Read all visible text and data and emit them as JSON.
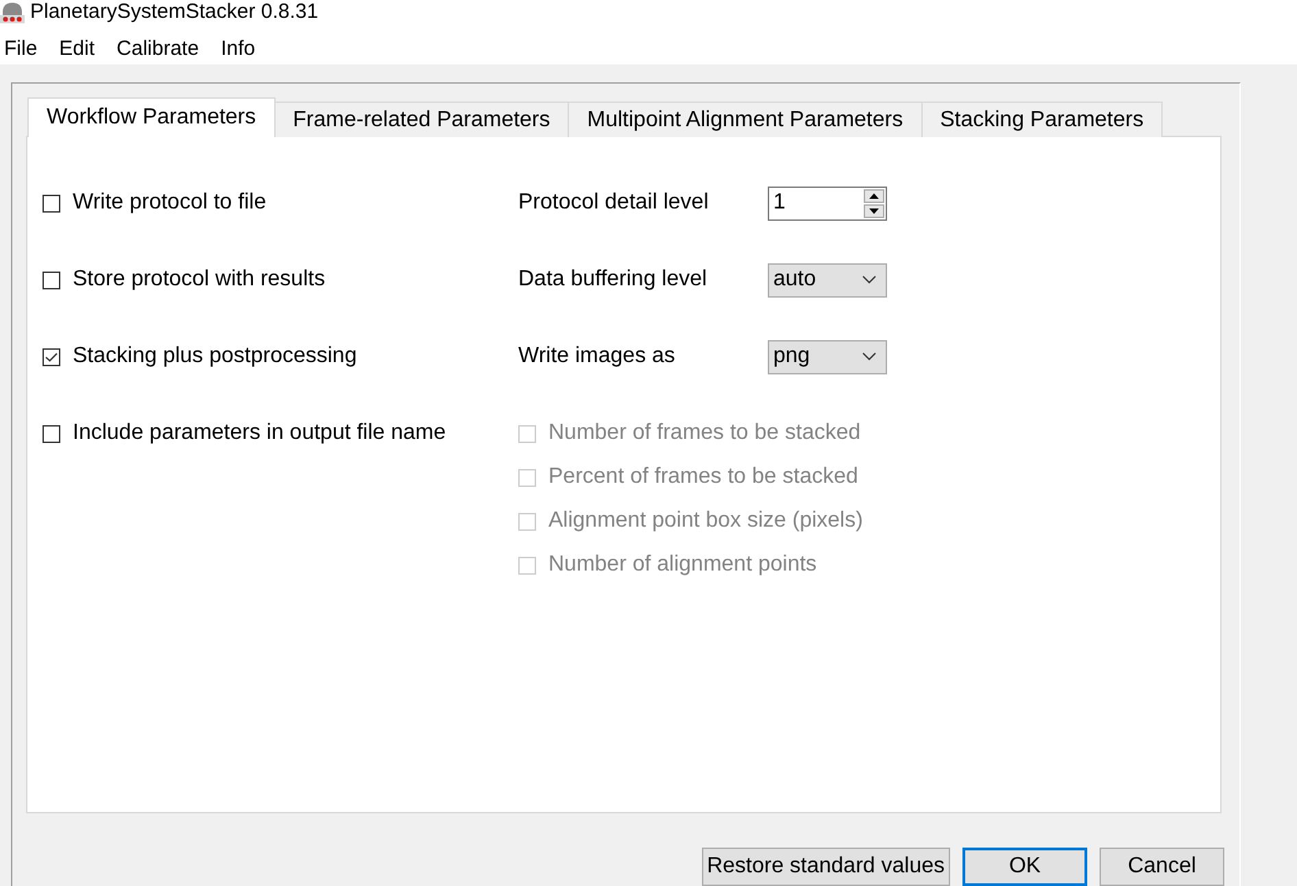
{
  "window": {
    "title": "PlanetarySystemStacker 0.8.31"
  },
  "menu": [
    "File",
    "Edit",
    "Calibrate",
    "Info"
  ],
  "tabs": [
    {
      "label": "Workflow Parameters",
      "selected": true
    },
    {
      "label": "Frame-related Parameters",
      "selected": false
    },
    {
      "label": "Multipoint Alignment Parameters",
      "selected": false
    },
    {
      "label": "Stacking Parameters",
      "selected": false
    }
  ],
  "options": [
    {
      "label": "Write protocol to file",
      "checked": false,
      "disabled": false
    },
    {
      "label": "Store protocol with results",
      "checked": false,
      "disabled": false
    },
    {
      "label": "Stacking plus postprocessing",
      "checked": true,
      "disabled": false
    },
    {
      "label": "Include parameters in output file name",
      "checked": false,
      "disabled": false
    }
  ],
  "settings": [
    {
      "label": "Protocol detail level",
      "kind": "spinbox",
      "value": "1"
    },
    {
      "label": "Data buffering level",
      "kind": "dropdown",
      "value": "auto"
    },
    {
      "label": "Write images as",
      "kind": "dropdown",
      "value": "png"
    }
  ],
  "parameter_options": [
    {
      "label": "Number of frames to be stacked",
      "checked": false,
      "disabled": true
    },
    {
      "label": "Percent of frames to be stacked",
      "checked": false,
      "disabled": true
    },
    {
      "label": "Alignment point box size (pixels)",
      "checked": false,
      "disabled": true
    },
    {
      "label": "Number of alignment points",
      "checked": false,
      "disabled": true
    }
  ],
  "buttons": [
    {
      "label": "Restore standard values",
      "default": false
    },
    {
      "label": "OK",
      "default": true
    },
    {
      "label": "Cancel",
      "default": false
    }
  ]
}
